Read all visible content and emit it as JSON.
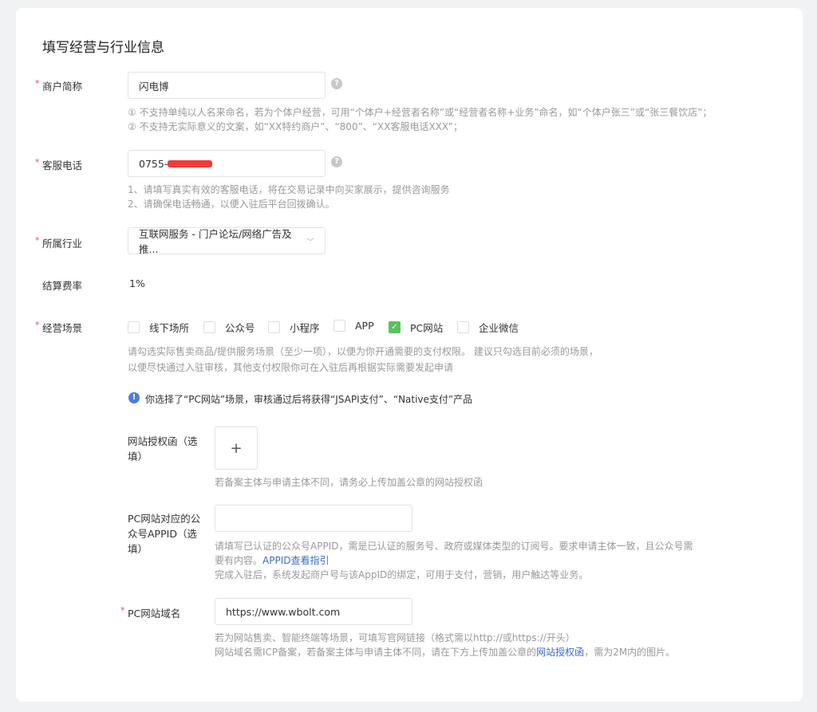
{
  "title": "填写经营与行业信息",
  "merchant_name": {
    "label": "商户简称",
    "value": "闪电博",
    "help_icon": "question-icon",
    "hints": [
      "① 不支持单纯以人名来命名，若为个体户经营，可用“个体户+经营者名称”或“经营者名称+业务”命名，如“个体户张三”或“张三餐饮店”；",
      "② 不支持无实际意义的文案，如“XX特约商户”、“800”、“XX客服电话XXX”；"
    ]
  },
  "service_phone": {
    "label": "客服电话",
    "value": "0755-",
    "help_icon": "question-icon",
    "hints": [
      "1、请填写真实有效的客服电话，将在交易记录中向买家展示，提供咨询服务",
      "2、请确保电话畅通，以便入驻后平台回拨确认。"
    ]
  },
  "industry": {
    "label": "所属行业",
    "value": "互联网服务 - 门户论坛/网络广告及推..."
  },
  "fee_rate": {
    "label": "结算费率",
    "value": "1%"
  },
  "scenarios": {
    "label": "经营场景",
    "options": [
      {
        "label": "线下场所",
        "checked": false
      },
      {
        "label": "公众号",
        "checked": false
      },
      {
        "label": "小程序",
        "checked": false
      },
      {
        "label": "APP",
        "checked": false
      },
      {
        "label": "PC网站",
        "checked": true
      },
      {
        "label": "企业微信",
        "checked": false
      }
    ],
    "hints": [
      "请勾选实际售卖商品/提供服务场景（至少一项），以便为你开通需要的支付权限。 建议只勾选目前必须的场景，",
      "以便尽快通过入驻审核，其他支付权限你可在入驻后再根据实际需要发起申请"
    ],
    "notice": "你选择了“PC网站”场景，审核通过后将获得“JSAPI支付”、“Native支付”产品"
  },
  "auth_letter": {
    "label": "网站授权函（选填）",
    "upload": "+",
    "hint": "若备案主体与申请主体不同，请务必上传加盖公章的网站授权函"
  },
  "appid": {
    "label": "PC网站对应的公众号APPID（选填）",
    "value": "",
    "hint1": "请填写已认证的公众号APPID，需是已认证的服务号、政府或媒体类型的订阅号。要求申请主体一致，且公众号需",
    "hint2": "要有内容。",
    "link": "APPID查看指引",
    "hint3": "完成入驻后，系统发起商户号与该AppID的绑定，可用于支付，营销，用户触达等业务。"
  },
  "domain": {
    "label": "PC网站域名",
    "value": "https://www.wbolt.com",
    "hint1": "若为网站售卖、智能终端等场景，可填写官网链接（格式需以http://或https://开头）",
    "hint2a": "网站域名需ICP备案，若备案主体与申请主体不同，请在下方上传加盖公章的",
    "link": "网站授权函",
    "hint2b": "，需为2M内的图片。"
  },
  "colors": {
    "accent": "#3e6ac5",
    "check": "#5ac25f",
    "required": "#e34d59"
  }
}
